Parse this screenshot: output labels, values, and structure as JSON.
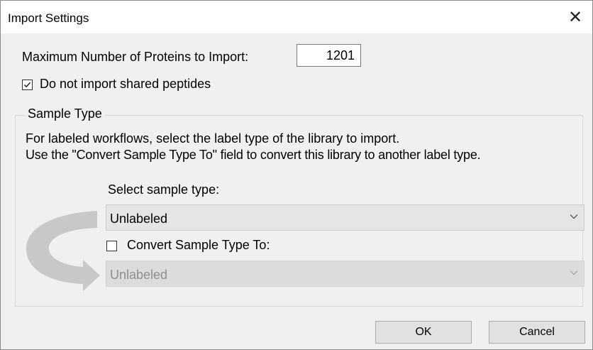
{
  "window": {
    "title": "Import Settings",
    "close_glyph": "✕"
  },
  "max_proteins": {
    "label": "Maximum Number of Proteins to Import:",
    "value": "1201"
  },
  "shared_peptides": {
    "label": "Do not import shared peptides",
    "checked": true
  },
  "sample_type": {
    "group_label": "Sample Type",
    "description_line1": "For labeled workflows, select the label type of the library to import.",
    "description_line2": "Use the \"Convert Sample Type To\" field to convert this library to another label type.",
    "select_label": "Select sample type:",
    "select_value": "Unlabeled",
    "convert_label": "Convert Sample Type To:",
    "convert_checked": false,
    "convert_value": "Unlabeled"
  },
  "buttons": {
    "ok": "OK",
    "cancel": "Cancel"
  },
  "icons": {
    "close": "close-icon",
    "checkbox_checked": "checkmark-icon",
    "dropdown": "chevron-down-icon",
    "convert_arrow": "curved-arrow-icon"
  },
  "colors": {
    "background": "#f0f0f0",
    "titlebar": "#ffffff",
    "arrow": "#c8c8c8"
  }
}
